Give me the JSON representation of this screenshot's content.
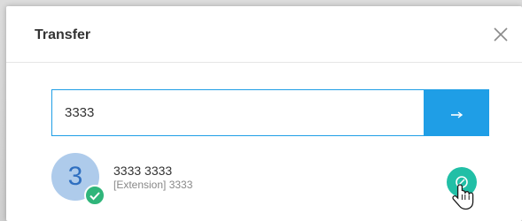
{
  "dialog": {
    "title": "Transfer"
  },
  "search": {
    "value": "3333"
  },
  "contact": {
    "avatar_initial": "3",
    "name": "3333 3333",
    "subtitle": "[Extension] 3333",
    "status": "available"
  },
  "icons": {
    "close": "close-icon",
    "go": "arrow-right-icon",
    "status": "check-icon",
    "transfer": "transfer-icon",
    "cursor": "hand-pointer-icon"
  },
  "colors": {
    "accent": "#1f9ee6",
    "status_green": "#2fb57a",
    "transfer_teal": "#21bfa6",
    "avatar_bg": "#aecbeb"
  }
}
